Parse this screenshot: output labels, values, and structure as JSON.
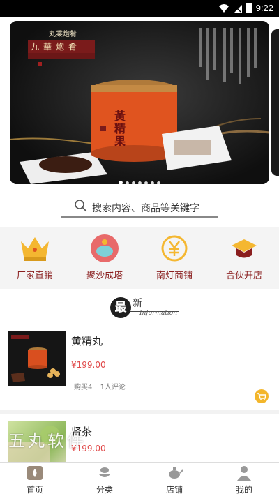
{
  "status_bar": {
    "time": "9:22"
  },
  "banner": {
    "box_title": "黃精果",
    "label_top": "丸乘炮肴",
    "header_text": "九華炮肴",
    "vertical_text": [
      "石",
      "斛",
      "伴",
      "君",
      "長",
      "壽",
      "人",
      "參",
      "果",
      "延",
      "年"
    ],
    "dot_count": 7,
    "active_dot": 0
  },
  "search": {
    "placeholder": "搜索内容、商品等关键字"
  },
  "quick_nav": [
    {
      "label": "厂家直销",
      "icon": "crown-icon"
    },
    {
      "label": "聚沙成塔",
      "icon": "piggy-bank-icon"
    },
    {
      "label": "南灯商铺",
      "icon": "yen-coin-icon"
    },
    {
      "label": "合伙开店",
      "icon": "graduation-cap-icon"
    }
  ],
  "newest": {
    "main_char": "最",
    "second_char": "新",
    "sub_text": "Information"
  },
  "products": [
    {
      "name": "黄精丸",
      "price": "¥199.00",
      "sold": "购买4",
      "reviews": "1人评论"
    },
    {
      "name": "肾茶",
      "price": "¥199.00"
    }
  ],
  "watermark": "五丸软件",
  "tabs": [
    {
      "label": "首页",
      "icon": "home-icon",
      "active": true
    },
    {
      "label": "分类",
      "icon": "category-icon"
    },
    {
      "label": "店铺",
      "icon": "teapot-icon"
    },
    {
      "label": "我的",
      "icon": "user-icon"
    }
  ],
  "colors": {
    "accent": "#8a1e1e",
    "price": "#e04848",
    "cart": "#f3b62b"
  }
}
